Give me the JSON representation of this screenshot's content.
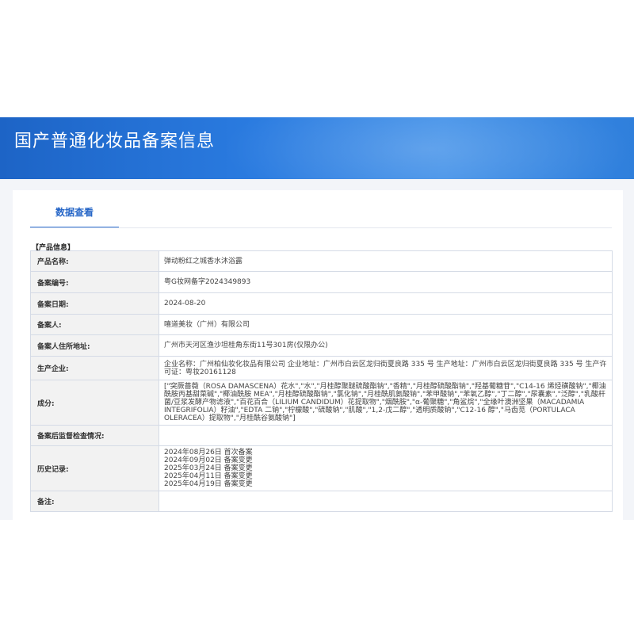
{
  "header": {
    "title": "国产普通化妆品备案信息"
  },
  "tabs": [
    {
      "label": "数据查看"
    }
  ],
  "section": {
    "title": "【产品信息】"
  },
  "rows": [
    {
      "label": "产品名称:",
      "value": "弹动粉红之城香水沐浴露"
    },
    {
      "label": "备案编号:",
      "value": "粤G妆网备字2024349893"
    },
    {
      "label": "备案日期:",
      "value": "2024-08-20"
    },
    {
      "label": "备案人:",
      "value": "嘻道美妆（广州）有限公司"
    },
    {
      "label": "备案人住所地址:",
      "value": "广州市天河区渔沙坦桂角东街11号301房(仅限办公)"
    },
    {
      "label": "生产企业:",
      "value": "企业名称：广州柏仙妆化妆品有限公司 企业地址：广州市白云区龙归街夏良路 335 号 生产地址：广州市白云区龙归街夏良路 335 号 生产许可证：粤妆20161128"
    },
    {
      "label": "成分:",
      "value": "[\"突厥蔷薇（ROSA DAMASCENA）花水\",\"水\",\"月桂醇聚醚硫酸酯钠\",\"香精\",\"月桂醇硫酸酯钠\",\"羟基葡糖苷\",\"C14-16 烯烃磺酸钠\",\"椰油酰胺丙基甜菜碱\",\"椰油酰胺 MEA\",\"月桂醇硫酸酯钠\",\"氯化钠\",\"月桂酰肌氨酸钠\",\"苯甲酸钠\",\"苯氧乙醇\",\"丁二醇\",\"尿囊素\",\"泛醇\",\"乳酸杆菌/豆浆发酵产物滤液\",\"百花百合（LILIUM CANDIDUM）花提取物\",\"烟酰胺\",\"α-葡聚糖\",\"角鲨烷\",\"全缘叶澳洲坚果（MACADAMIA INTEGRIFOLIA）籽油\",\"EDTA 二钠\",\"柠檬酸\",\"硫酸钠\",\"肌酸\",\"1,2-戊二醇\",\"透明质酸钠\",\"C12-16 醇\",\"马齿苋（PORTULACA OLERACEA）提取物\",\"月桂酰谷氨酸钠\"]"
    },
    {
      "label": "备案后监督检查情况:",
      "value": ""
    },
    {
      "label": "历史记录:",
      "value": "2024年08月26日 首次备案\n2024年09月02日 备案变更\n2025年03月24日 备案变更\n2025年04月11日 备案变更\n2025年04月19日 备案变更"
    },
    {
      "label": "备注:",
      "value": ""
    }
  ]
}
